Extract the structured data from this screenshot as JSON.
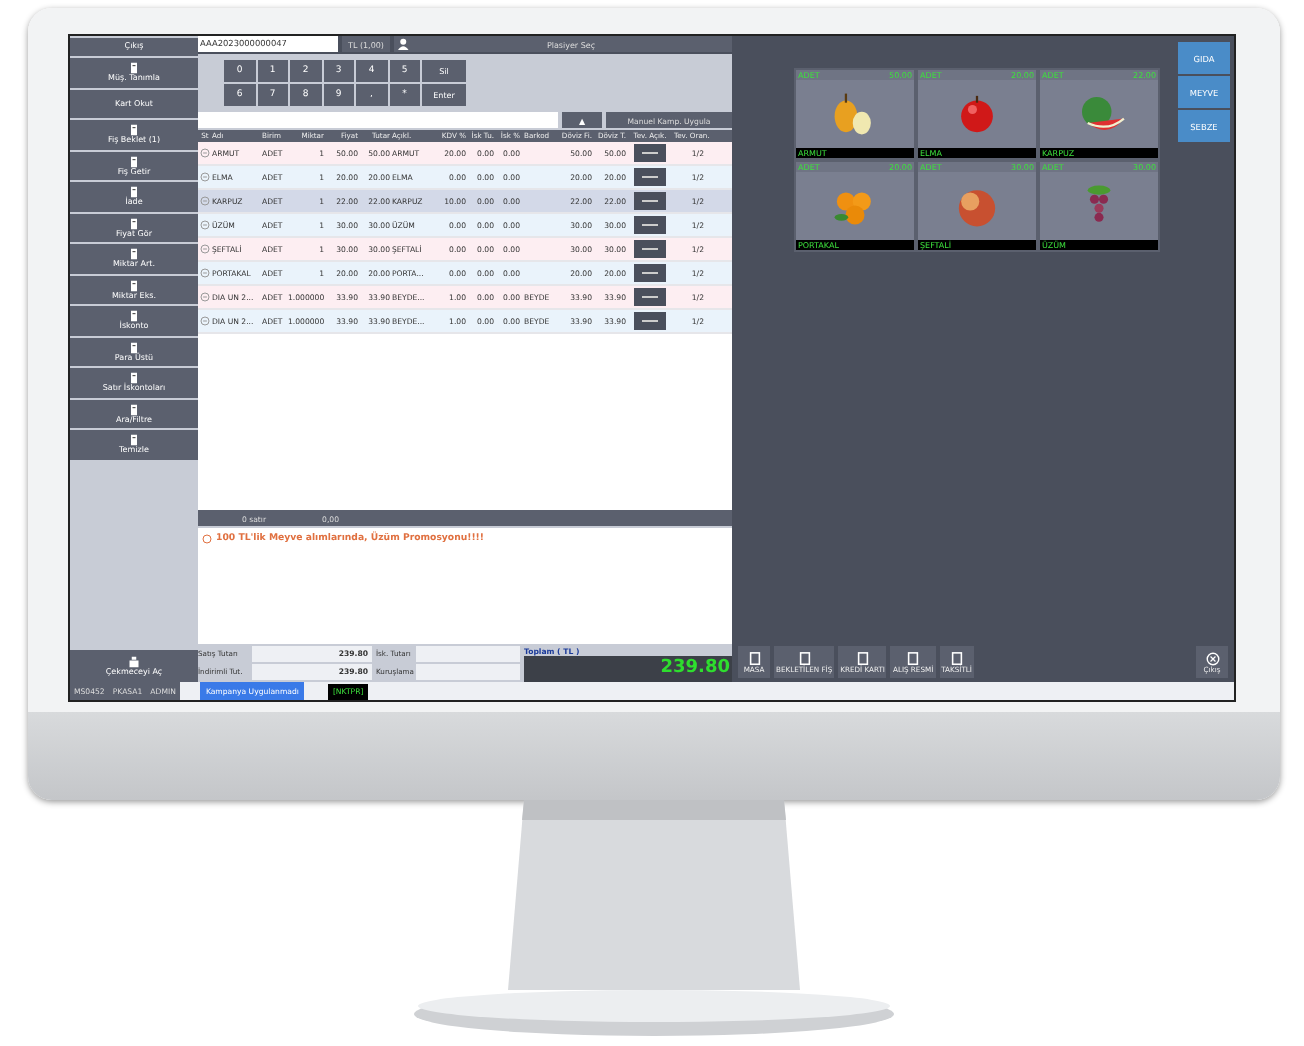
{
  "sidebar": {
    "exit": "Çıkış",
    "items": [
      {
        "label": "Müş. Tanımla",
        "icon": true
      },
      {
        "label": "Kart Okut",
        "icon": false
      },
      {
        "label": "Fiş Beklet (1)",
        "icon": true
      },
      {
        "label": "Fiş Getir",
        "icon": true
      },
      {
        "label": "İade",
        "icon": true
      },
      {
        "label": "Fiyat Gör",
        "icon": true
      },
      {
        "label": "Miktar Art.",
        "icon": true
      },
      {
        "label": "Miktar Eks.",
        "icon": true
      },
      {
        "label": "İskonto",
        "icon": true
      },
      {
        "label": "Para Üstü",
        "icon": true
      },
      {
        "label": "Satır İskontoları",
        "icon": true
      },
      {
        "label": "Ara/Filtre",
        "icon": true
      },
      {
        "label": "Temizle",
        "icon": true
      }
    ],
    "drawer": "Çekmeceyi Aç"
  },
  "barcode": "AAA2023000000047",
  "currency": "TL (1,00)",
  "salesperson": "Plasiyer Seç",
  "numpad": [
    [
      "0",
      "1",
      "2",
      "3",
      "4",
      "5",
      "Sil"
    ],
    [
      "6",
      "7",
      "8",
      "9",
      ",",
      "*",
      "Enter"
    ]
  ],
  "search_button": "▲",
  "campaign_button": "Manuel Kamp. Uygula",
  "table": {
    "columns": [
      "St",
      "Adı",
      "Birim",
      "Miktar",
      "Fiyat",
      "Tutar",
      "Açıkl.",
      "KDV %",
      "İsk Tu.",
      "İsk %",
      "Barkod",
      "Döviz Fi.",
      "Döviz T.",
      "Tev. Açık.",
      "Tev. Oran."
    ],
    "rows": [
      {
        "cells": [
          "",
          "ARMUT",
          "ADET",
          "1",
          "50.00",
          "50.00",
          "ARMUT",
          "20.00",
          "0.00",
          "0.00",
          "",
          "50.00",
          "50.00",
          "",
          "1/2"
        ],
        "selected": false
      },
      {
        "cells": [
          "",
          "ELMA",
          "ADET",
          "1",
          "20.00",
          "20.00",
          "ELMA",
          "0.00",
          "0.00",
          "0.00",
          "",
          "20.00",
          "20.00",
          "",
          "1/2"
        ],
        "selected": false
      },
      {
        "cells": [
          "",
          "KARPUZ",
          "ADET",
          "1",
          "22.00",
          "22.00",
          "KARPUZ",
          "10.00",
          "0.00",
          "0.00",
          "",
          "22.00",
          "22.00",
          "",
          "1/2"
        ],
        "selected": true
      },
      {
        "cells": [
          "",
          "ÜZÜM",
          "ADET",
          "1",
          "30.00",
          "30.00",
          "ÜZÜM",
          "0.00",
          "0.00",
          "0.00",
          "",
          "30.00",
          "30.00",
          "",
          "1/2"
        ],
        "selected": false
      },
      {
        "cells": [
          "",
          "ŞEFTALİ",
          "ADET",
          "1",
          "30.00",
          "30.00",
          "ŞEFTALİ",
          "0.00",
          "0.00",
          "0.00",
          "",
          "30.00",
          "30.00",
          "",
          "1/2"
        ],
        "selected": false
      },
      {
        "cells": [
          "",
          "PORTAKAL",
          "ADET",
          "1",
          "20.00",
          "20.00",
          "PORTA...",
          "0.00",
          "0.00",
          "0.00",
          "",
          "20.00",
          "20.00",
          "",
          "1/2"
        ],
        "selected": false
      },
      {
        "cells": [
          "",
          "DIA UN 2...",
          "ADET",
          "1.000000",
          "33.90",
          "33.90",
          "BEYDE...",
          "1.00",
          "0.00",
          "0.00",
          "BEYDE",
          "33.90",
          "33.90",
          "",
          "1/2"
        ],
        "selected": false
      },
      {
        "cells": [
          "",
          "DIA UN 2...",
          "ADET",
          "1.000000",
          "33.90",
          "33.90",
          "BEYDE...",
          "1.00",
          "0.00",
          "0.00",
          "BEYDE",
          "33.90",
          "33.90",
          "",
          "1/2"
        ],
        "selected": false
      }
    ]
  },
  "summary_bar": [
    "0 satır",
    "0,00"
  ],
  "message": "100 TL'lik Meyve alımlarında, Üzüm Promosyonu!!!!",
  "totals": [
    {
      "label": "Satış Tutarı",
      "value": "239.80"
    },
    {
      "label": "İndirimli Tut.",
      "value": "239.80"
    },
    {
      "label": "İsk. Tutarı"
    },
    {
      "label": "Kuruşlama"
    }
  ],
  "grand_total": {
    "label": "Toplam ( TL )",
    "value": "239.80"
  },
  "status_bar": {
    "items": [
      "MS0452",
      "PKASA1",
      "ADMIN"
    ],
    "campaign": "Kampanya Uygulanmadı",
    "printer": "[NKTPR]"
  },
  "products": [
    {
      "unit": "ADET",
      "price": "50.00",
      "name": "ARMUT"
    },
    {
      "unit": "ADET",
      "price": "20.00",
      "name": "ELMA"
    },
    {
      "unit": "ADET",
      "price": "22.00",
      "name": "KARPUZ"
    },
    {
      "unit": "ADET",
      "price": "20.00",
      "name": "PORTAKAL"
    },
    {
      "unit": "ADET",
      "price": "30.00",
      "name": "ŞEFTALİ"
    },
    {
      "unit": "ADET",
      "price": "30.00",
      "name": "ÜZÜM"
    }
  ],
  "categories": [
    {
      "label": "GIDA",
      "selected": false
    },
    {
      "label": "MEYVE",
      "selected": false
    },
    {
      "label": "SEBZE",
      "selected": false
    }
  ],
  "actions": [
    "MASA",
    "BEKLETİLEN FİŞ",
    "KREDİ KARTI",
    "ALIŞ RESMİ",
    "TAKSİTLİ"
  ],
  "close": "Çıkış"
}
